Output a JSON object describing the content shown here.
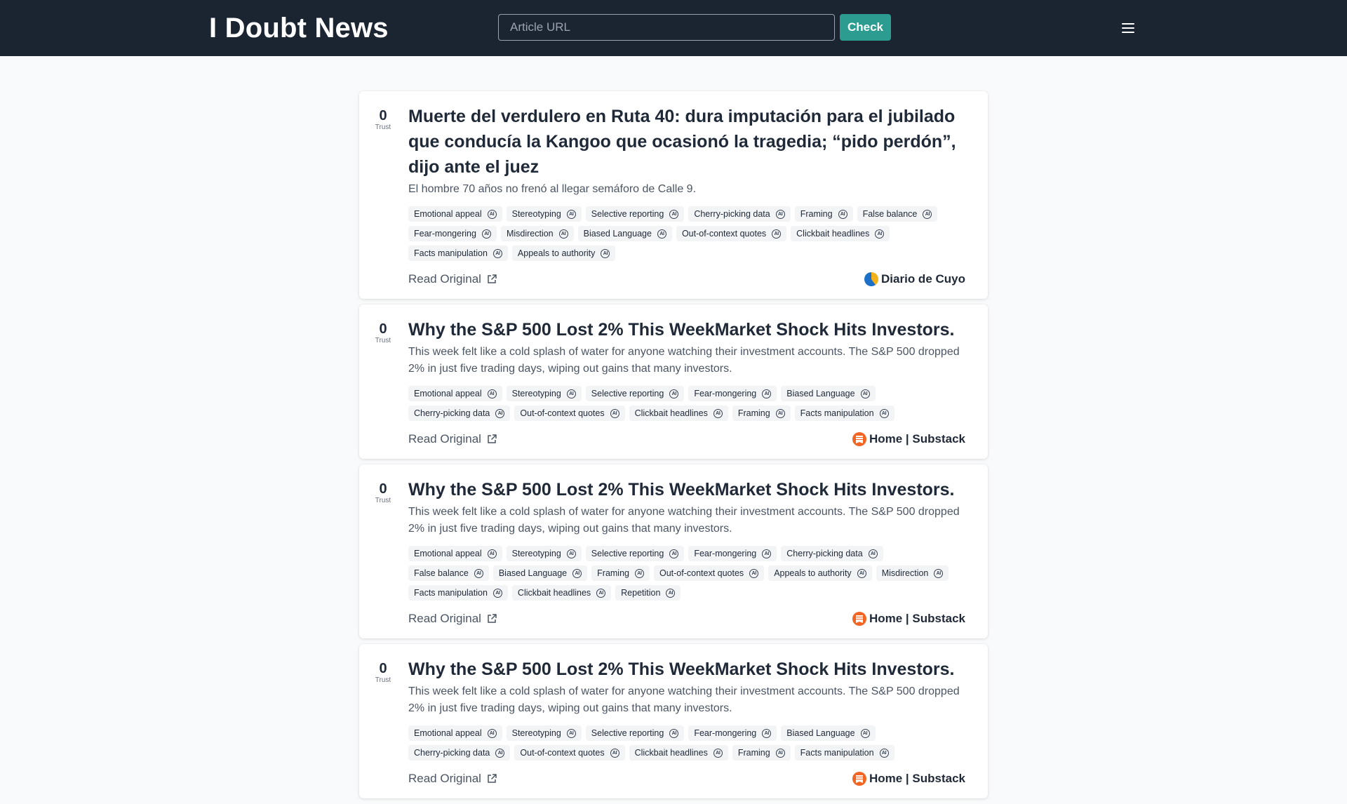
{
  "header": {
    "brand": "I Doubt News",
    "url_placeholder": "Article URL",
    "check_label": "Check"
  },
  "articles": [
    {
      "trust_score": "0",
      "trust_label": "Trust",
      "title": "Muerte del verdulero en Ruta 40: dura imputación para el jubilado que conducía la Kangoo que ocasionó la tragedia; “pido perdón”, dijo ante el juez",
      "subtitle": "El hombre 70 años no frenó al llegar semáforo de Calle 9.",
      "tags": [
        "Emotional appeal",
        "Stereotyping",
        "Selective reporting",
        "Cherry-picking data",
        "Framing",
        "False balance",
        "Fear-mongering",
        "Misdirection",
        "Biased Language",
        "Out-of-context quotes",
        "Clickbait headlines",
        "Facts manipulation",
        "Appeals to authority"
      ],
      "read_label": "Read Original",
      "source": "Diario de Cuyo",
      "source_icon": "diario-de-cuyo-logo"
    },
    {
      "trust_score": "0",
      "trust_label": "Trust",
      "title": "Why the S&P 500 Lost 2% This WeekMarket Shock Hits Investors.",
      "subtitle": "This week felt like a cold splash of water for anyone watching their investment accounts. The S&P 500 dropped 2% in just five trading days, wiping out gains that many investors.",
      "tags": [
        "Emotional appeal",
        "Stereotyping",
        "Selective reporting",
        "Fear-mongering",
        "Biased Language",
        "Cherry-picking data",
        "Out-of-context quotes",
        "Clickbait headlines",
        "Framing",
        "Facts manipulation"
      ],
      "read_label": "Read Original",
      "source": "Home | Substack",
      "source_icon": "substack-logo"
    },
    {
      "trust_score": "0",
      "trust_label": "Trust",
      "title": "Why the S&P 500 Lost 2% This WeekMarket Shock Hits Investors.",
      "subtitle": "This week felt like a cold splash of water for anyone watching their investment accounts. The S&P 500 dropped 2% in just five trading days, wiping out gains that many investors.",
      "tags": [
        "Emotional appeal",
        "Stereotyping",
        "Selective reporting",
        "Fear-mongering",
        "Cherry-picking data",
        "False balance",
        "Biased Language",
        "Framing",
        "Out-of-context quotes",
        "Appeals to authority",
        "Misdirection",
        "Facts manipulation",
        "Clickbait headlines",
        "Repetition"
      ],
      "read_label": "Read Original",
      "source": "Home | Substack",
      "source_icon": "substack-logo"
    },
    {
      "trust_score": "0",
      "trust_label": "Trust",
      "title": "Why the S&P 500 Lost 2% This WeekMarket Shock Hits Investors.",
      "subtitle": "This week felt like a cold splash of water for anyone watching their investment accounts. The S&P 500 dropped 2% in just five trading days, wiping out gains that many investors.",
      "tags": [
        "Emotional appeal",
        "Stereotyping",
        "Selective reporting",
        "Fear-mongering",
        "Biased Language",
        "Cherry-picking data",
        "Out-of-context quotes",
        "Clickbait headlines",
        "Framing",
        "Facts manipulation"
      ],
      "read_label": "Read Original",
      "source": "Home | Substack",
      "source_icon": "substack-logo"
    }
  ],
  "tag_badge": "AI",
  "colors": {
    "header_bg": "#1b2431",
    "accent": "#2c9c91",
    "page_bg": "#f9fafb",
    "tag_bg": "#f3f4f6",
    "substack": "#f26522"
  }
}
